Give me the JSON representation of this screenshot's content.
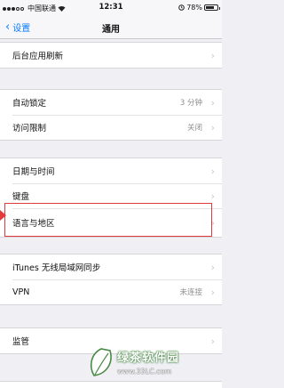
{
  "status": {
    "carrier": "中国联通",
    "time": "12:31",
    "battery": "78%",
    "battery_level": 0.78
  },
  "nav": {
    "back_label": "设置",
    "title": "通用"
  },
  "rows": {
    "background_refresh": "后台应用刷新",
    "auto_lock": {
      "label": "自动锁定",
      "value": "3 分钟"
    },
    "restrictions": {
      "label": "访问限制",
      "value": "关闭"
    },
    "date_time": "日期与时间",
    "keyboard": "键盘",
    "language_region": "语言与地区",
    "itunes_sync": "iTunes 无线局域网同步",
    "vpn": {
      "label": "VPN",
      "value": "未连接"
    },
    "regulatory": "监管"
  },
  "watermark": {
    "brand": "绿茶软件园",
    "url": "www.33LC.com"
  },
  "colors": {
    "accent": "#0a7bff",
    "highlight": "#e23a3a"
  }
}
